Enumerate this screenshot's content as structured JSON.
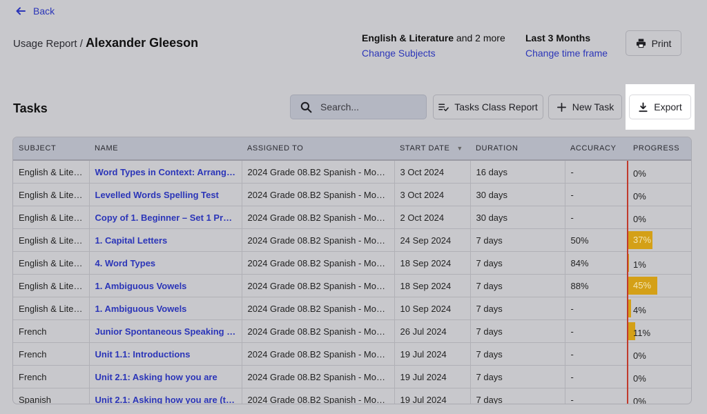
{
  "back_label": "Back",
  "breadcrumb": {
    "prefix": "Usage Report /",
    "student": "Alexander Gleeson"
  },
  "subjects": {
    "bold": "English & Literature",
    "rest": "and 2 more",
    "link": "Change Subjects"
  },
  "timeframe": {
    "label": "Last 3 Months",
    "link": "Change time frame"
  },
  "print_label": "Print",
  "tasks_title": "Tasks",
  "search": {
    "placeholder": "Search..."
  },
  "toolbar": {
    "class_report": "Tasks Class Report",
    "new_task": "New Task",
    "export": "Export"
  },
  "colors": {
    "link": "#2b35b8",
    "progress_bar": "#d4a017",
    "progress_marker": "#c0392b",
    "highlight": "#ffffff"
  },
  "table": {
    "headers": [
      "SUBJECT",
      "NAME",
      "ASSIGNED TO",
      "START DATE",
      "DURATION",
      "ACCURACY",
      "PROGRESS"
    ],
    "rows": [
      {
        "subject": "English & Liter...",
        "name": "Word Types in Context: Arrange ...",
        "assigned": "2024 Grade 08.B2 Spanish - Monta...",
        "start": "3 Oct 2024",
        "duration": "16 days",
        "accuracy": "-",
        "progress": "0%",
        "progress_value": 0
      },
      {
        "subject": "English & Liter...",
        "name": "Levelled Words Spelling Test",
        "assigned": "2024 Grade 08.B2 Spanish - Monta...",
        "start": "3 Oct 2024",
        "duration": "30 days",
        "accuracy": "-",
        "progress": "0%",
        "progress_value": 0
      },
      {
        "subject": "English & Liter...",
        "name": "Copy of 1. Beginner – Set 1 Pre-t...",
        "assigned": "2024 Grade 08.B2 Spanish - Monta...",
        "start": "2 Oct 2024",
        "duration": "30 days",
        "accuracy": "-",
        "progress": "0%",
        "progress_value": 0
      },
      {
        "subject": "English & Liter...",
        "name": "1. Capital Letters",
        "assigned": "2024 Grade 08.B2 Spanish - Monta...",
        "start": "24 Sep 2024",
        "duration": "7 days",
        "accuracy": "50%",
        "progress": "37%",
        "progress_value": 37
      },
      {
        "subject": "English & Liter...",
        "name": "4. Word Types",
        "assigned": "2024 Grade 08.B2 Spanish - Monta...",
        "start": "18 Sep 2024",
        "duration": "7 days",
        "accuracy": "84%",
        "progress": "1%",
        "progress_value": 1
      },
      {
        "subject": "English & Liter...",
        "name": "1. Ambiguous Vowels",
        "assigned": "2024 Grade 08.B2 Spanish - Monta...",
        "start": "18 Sep 2024",
        "duration": "7 days",
        "accuracy": "88%",
        "progress": "45%",
        "progress_value": 45
      },
      {
        "subject": "English & Liter...",
        "name": "1. Ambiguous Vowels",
        "assigned": "2024 Grade 08.B2 Spanish - Monta...",
        "start": "10 Sep 2024",
        "duration": "7 days",
        "accuracy": "-",
        "progress": "4%",
        "progress_value": 4
      },
      {
        "subject": "French",
        "name": "Junior Spontaneous Speaking Q...",
        "assigned": "2024 Grade 08.B2 Spanish - Monta...",
        "start": "26 Jul 2024",
        "duration": "7 days",
        "accuracy": "-",
        "progress": "11%",
        "progress_value": 11
      },
      {
        "subject": "French",
        "name": "Unit 1.1: Introductions",
        "assigned": "2024 Grade 08.B2 Spanish - Monta...",
        "start": "19 Jul 2024",
        "duration": "7 days",
        "accuracy": "-",
        "progress": "0%",
        "progress_value": 0
      },
      {
        "subject": "French",
        "name": "Unit 2.1: Asking how you are",
        "assigned": "2024 Grade 08.B2 Spanish - Monta...",
        "start": "19 Jul 2024",
        "duration": "7 days",
        "accuracy": "-",
        "progress": "0%",
        "progress_value": 0
      },
      {
        "subject": "Spanish",
        "name": "Unit 2.1: Asking how you are (tr...",
        "assigned": "2024 Grade 08.B2 Spanish - Monta...",
        "start": "19 Jul 2024",
        "duration": "7 days",
        "accuracy": "-",
        "progress": "0%",
        "progress_value": 0
      }
    ]
  }
}
